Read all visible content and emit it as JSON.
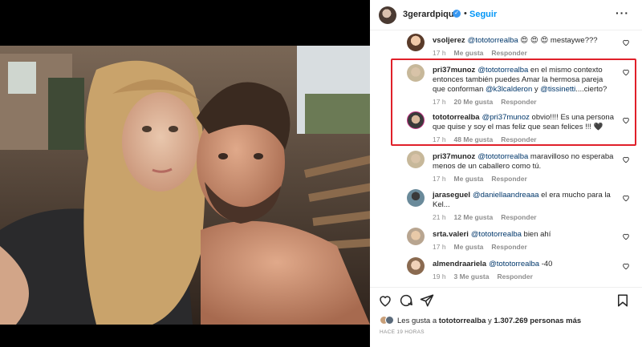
{
  "post": {
    "username": "3gerardpique",
    "separator": "•",
    "follow_label": "Seguir",
    "more_label": "···"
  },
  "comments": [
    {
      "user": "vsoljerez",
      "mention": "@tototorrealba",
      "text": " 😍 😍 😍  mestaywe???",
      "time": "17 h",
      "likes": "",
      "reply": "Responder",
      "label_like": "Me gusta"
    },
    {
      "user": "pri37munoz",
      "mention": "@tototorrealba",
      "text": " en el mismo contexto entonces también puedes Amar la hermosa pareja que conforman ",
      "mention2": "@k3lcalderon",
      "text2": " y ",
      "mention3": "@tissinetti",
      "text3": "....cierto?",
      "time": "17 h",
      "likes": "20 Me gusta",
      "reply": "Responder"
    },
    {
      "user": "tototorrealba",
      "mention": "@pri37munoz",
      "text": " obvio!!!! Es una persona que quise y soy el mas feliz que sean felices !!! 🖤",
      "time": "17 h",
      "likes": "48 Me gusta",
      "reply": "Responder"
    },
    {
      "user": "pri37munoz",
      "mention": "@tototorrealba",
      "text": " maravilloso no esperaba menos de un caballero como tú.",
      "time": "17 h",
      "likes": "",
      "reply": "Responder",
      "label_like": "Me gusta"
    },
    {
      "user": "jaraseguel",
      "mention": "@daniellaandreaaa",
      "text": " el era mucho para la Kel...",
      "time": "21 h",
      "likes": "12 Me gusta",
      "reply": "Responder"
    },
    {
      "user": "srta.valeri",
      "mention": "@tototorrealba",
      "text": " bien ahí",
      "time": "17 h",
      "likes": "",
      "reply": "Responder",
      "label_like": "Me gusta"
    },
    {
      "user": "almendraariela",
      "mention": "@tototorrealba",
      "text": " -40",
      "time": "19 h",
      "likes": "3 Me gusta",
      "reply": "Responder"
    }
  ],
  "footer": {
    "liked_prefix": "Les gusta a ",
    "liked_user": "tototorrealba",
    "liked_mid": " y ",
    "liked_count": "1.307.269 personas más",
    "time_ago": "HACE 19 HORAS"
  },
  "icons": [
    "heart-icon",
    "comment-icon",
    "share-icon",
    "bookmark-icon",
    "verified-icon"
  ],
  "colors": {
    "accent": "#0095f6",
    "highlight": "#e0202a",
    "mention": "#00376b",
    "muted": "#8e8e8e"
  }
}
